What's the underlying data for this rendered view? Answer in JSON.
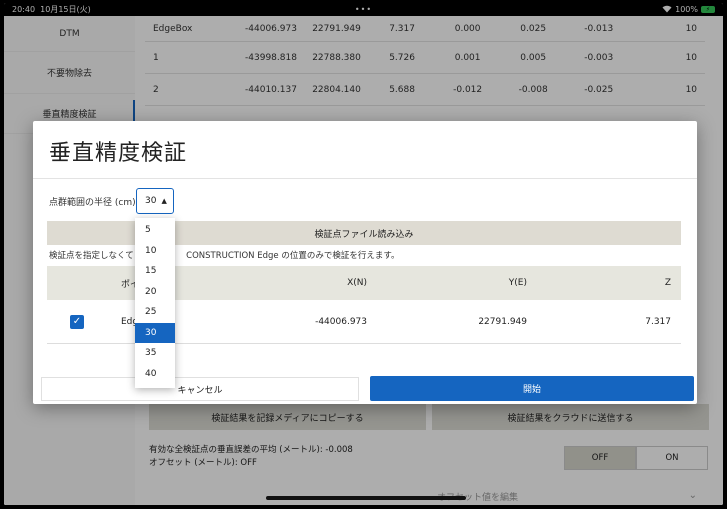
{
  "status": {
    "time": "20:40",
    "date": "10月15日(火)",
    "dots": "•••",
    "battery": "100%"
  },
  "sidebar": {
    "items": [
      {
        "label": "DTM"
      },
      {
        "label": "不要物除去"
      },
      {
        "label": "垂直精度検証"
      }
    ]
  },
  "bg_table": {
    "rows": [
      [
        "EdgeBox",
        "-44006.973",
        "22791.949",
        "7.317",
        "0.000",
        "0.025",
        "-0.013",
        "10"
      ],
      [
        "1",
        "-43998.818",
        "22788.380",
        "5.726",
        "0.001",
        "0.005",
        "-0.003",
        "10"
      ],
      [
        "2",
        "-44010.137",
        "22804.140",
        "5.688",
        "-0.012",
        "-0.008",
        "-0.025",
        "10"
      ]
    ]
  },
  "bg_buttons": {
    "copy": "検証結果を記録メディアにコピーする",
    "cloud": "検証結果をクラウドに送信する"
  },
  "bg_stats": {
    "line1": "有効な全検証点の垂直誤差の平均 (メートル): -0.008",
    "line2": "オフセット (メートル): OFF"
  },
  "bg_toggle": {
    "off": "OFF",
    "on": "ON"
  },
  "bg_offset_edit": "オフセット値を編集",
  "dialog": {
    "title": "垂直精度検証",
    "radius_label": "点群範囲の半径 (cm)",
    "radius_value": "30",
    "load_button": "検証点ファイル読み込み",
    "note_left": "検証点を指定しなくて",
    "note_right": "CONSTRUCTION Edge の位置のみで検証を行えます。",
    "table": {
      "headers": {
        "point": "ポイ",
        "x": "X(N)",
        "y": "Y(E)",
        "z": "Z"
      },
      "rows": [
        {
          "checked": true,
          "point": "Edg",
          "x": "-44006.973",
          "y": "22791.949",
          "z": "7.317"
        }
      ]
    },
    "cancel": "キャンセル",
    "start": "開始"
  },
  "dropdown": {
    "options": [
      "5",
      "10",
      "15",
      "20",
      "25",
      "30",
      "35",
      "40"
    ],
    "selected": "30"
  },
  "colors": {
    "accent": "#1565c0",
    "button_bg": "#dedbd2",
    "header_bg": "#e6e6de"
  }
}
